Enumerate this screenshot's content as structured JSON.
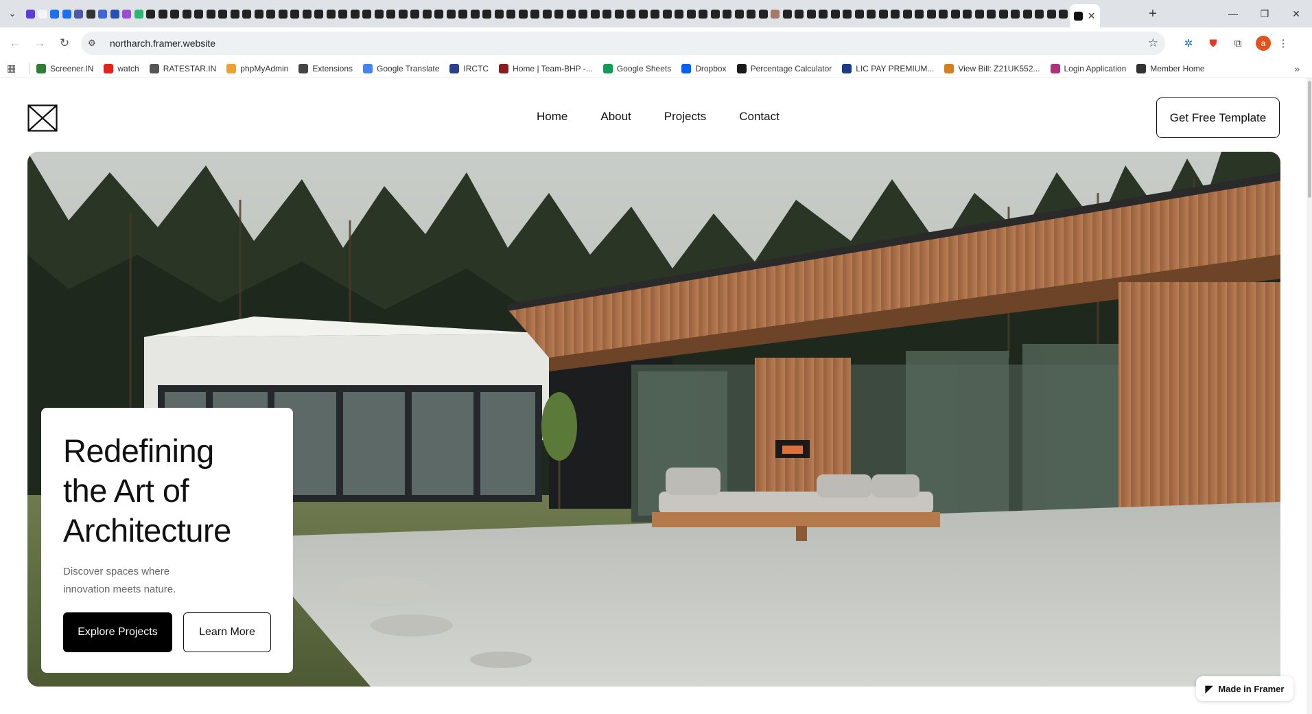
{
  "browser": {
    "url": "northarch.framer.website",
    "pinned_tab_colors": [
      "#5c3bd9",
      "#f4f4f4",
      "#1b6ff2",
      "#1b6ff2",
      "#4b5aa8",
      "#333",
      "#3e66d6",
      "#2550b8",
      "#9c4bd8",
      "#2bb673",
      "#222",
      "#222",
      "#222",
      "#222",
      "#222",
      "#222",
      "#222",
      "#222",
      "#222",
      "#222",
      "#222",
      "#222",
      "#222",
      "#222",
      "#222",
      "#222",
      "#222",
      "#222",
      "#222",
      "#222",
      "#222",
      "#222",
      "#222",
      "#222",
      "#222",
      "#222",
      "#222",
      "#222",
      "#222",
      "#222",
      "#222",
      "#222",
      "#222",
      "#222",
      "#222",
      "#222",
      "#222",
      "#222",
      "#222",
      "#222",
      "#222",
      "#222",
      "#222",
      "#222",
      "#222",
      "#222",
      "#222",
      "#222",
      "#222",
      "#222",
      "#222",
      "#222",
      "#a27b6a",
      "#222",
      "#222",
      "#222",
      "#222",
      "#222",
      "#222",
      "#222",
      "#222",
      "#222",
      "#222",
      "#222",
      "#222",
      "#222",
      "#222",
      "#222",
      "#222",
      "#222",
      "#222",
      "#222",
      "#222",
      "#222",
      "#222",
      "#222",
      "#222"
    ],
    "profile_initial": "a",
    "bookmarks": [
      {
        "label": "Screener.IN",
        "color": "#2e7d32"
      },
      {
        "label": "watch",
        "color": "#e62117"
      },
      {
        "label": "RATESTAR.IN",
        "color": "#555555"
      },
      {
        "label": "phpMyAdmin",
        "color": "#f0a030"
      },
      {
        "label": "Extensions",
        "color": "#444444"
      },
      {
        "label": "Google Translate",
        "color": "#4285f4"
      },
      {
        "label": "IRCTC",
        "color": "#2a3f8f"
      },
      {
        "label": "Home | Team-BHP -...",
        "color": "#8b1a1a"
      },
      {
        "label": "Google Sheets",
        "color": "#0f9d58"
      },
      {
        "label": "Dropbox",
        "color": "#0061fe"
      },
      {
        "label": "Percentage Calculator",
        "color": "#1a1a1a"
      },
      {
        "label": "LIC PAY PREMIUM...",
        "color": "#1a3a8a"
      },
      {
        "label": "View Bill: Z21UK552...",
        "color": "#d4801c"
      },
      {
        "label": "Login Application",
        "color": "#b0307a"
      },
      {
        "label": "Member Home",
        "color": "#333333"
      }
    ]
  },
  "site": {
    "nav": [
      "Home",
      "About",
      "Projects",
      "Contact"
    ],
    "cta_top": "Get Free Template",
    "hero": {
      "title_lines": [
        "Redefining",
        "the Art of",
        "Architecture"
      ],
      "subtitle": "Discover spaces where innovation meets nature.",
      "primary_button": "Explore Projects",
      "secondary_button": "Learn More"
    },
    "badge": "Made in Framer"
  }
}
